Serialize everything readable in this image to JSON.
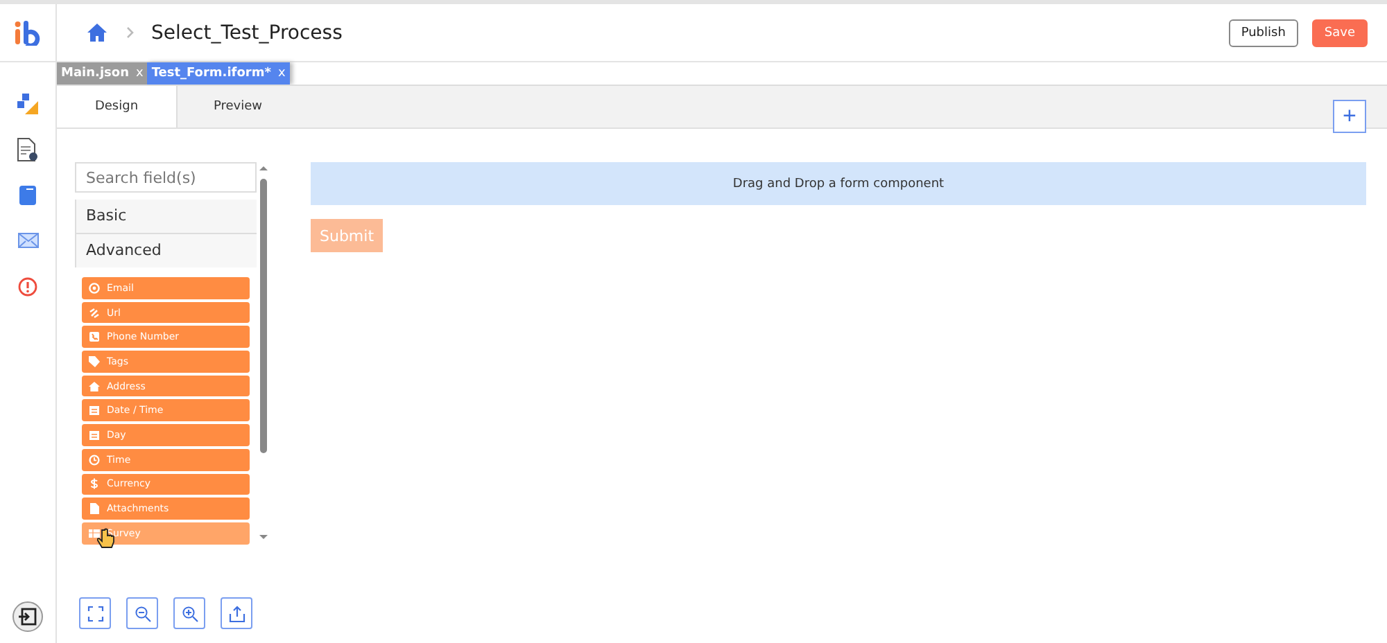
{
  "header": {
    "breadcrumb": "Select_Test_Process",
    "buttons": [
      {
        "label": "Publish",
        "kind": "outline"
      },
      {
        "label": "Save",
        "kind": "primary"
      }
    ]
  },
  "file_tabs": [
    {
      "label": "Main.json",
      "close": "x",
      "selected": false
    },
    {
      "label": "Test_Form.iform*",
      "close": "x",
      "selected": true
    }
  ],
  "view_tabs": [
    {
      "label": "Design",
      "selected": true
    },
    {
      "label": "Preview",
      "selected": false
    }
  ],
  "add_button": "+",
  "palette": {
    "search": {
      "placeholder": "Search field(s)"
    },
    "groups": [
      {
        "label": "Basic",
        "expanded": false
      },
      {
        "label": "Advanced",
        "expanded": true
      }
    ],
    "items": [
      {
        "label": "Email",
        "hovered": false
      },
      {
        "label": "Url",
        "hovered": false
      },
      {
        "label": "Phone Number",
        "hovered": false
      },
      {
        "label": "Tags",
        "hovered": false
      },
      {
        "label": "Address",
        "hovered": false
      },
      {
        "label": "Date / Time",
        "hovered": false
      },
      {
        "label": "Day",
        "hovered": false
      },
      {
        "label": "Time",
        "hovered": false
      },
      {
        "label": "Currency",
        "hovered": false
      },
      {
        "label": "Attachments",
        "hovered": false
      },
      {
        "label": "Survey",
        "hovered": true
      }
    ]
  },
  "canvas": {
    "dropzone": "Drag and Drop a form component",
    "submit": "Submit"
  }
}
